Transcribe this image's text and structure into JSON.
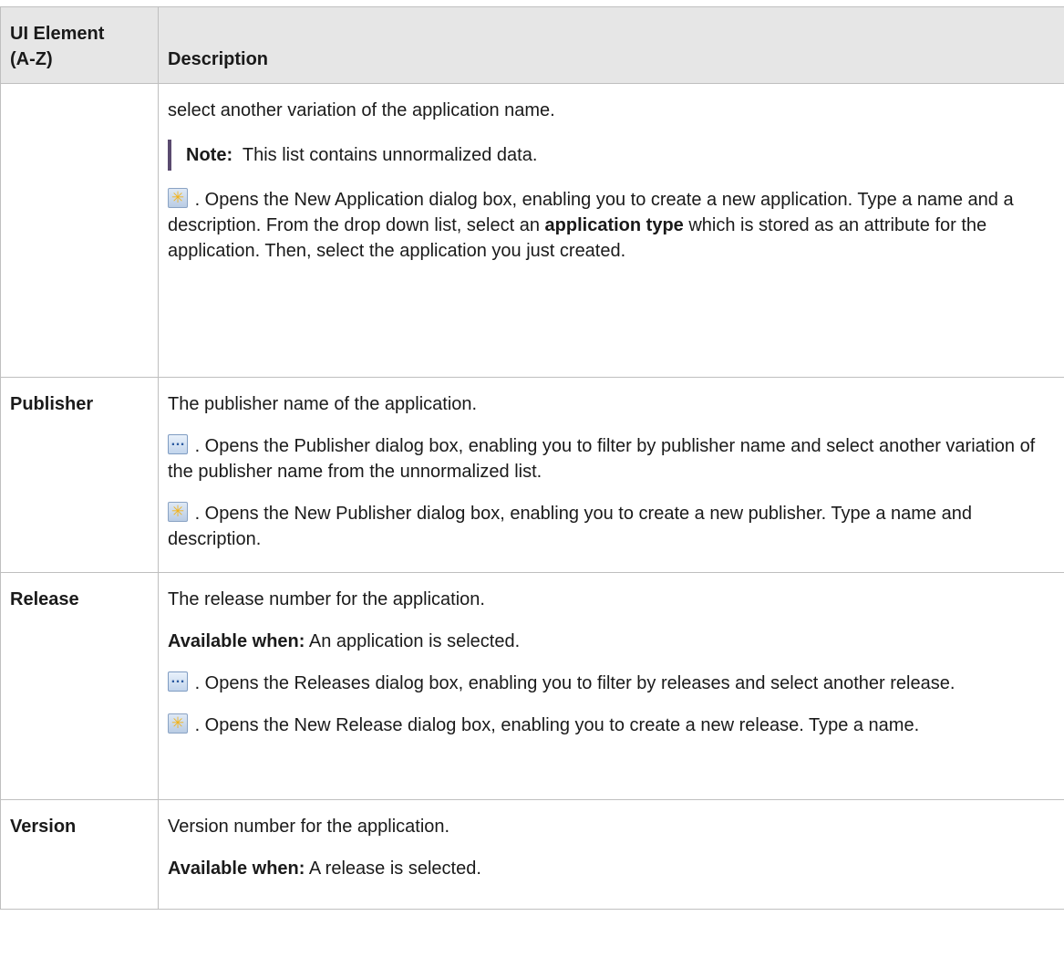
{
  "header": {
    "col1": "UI Element\n(A-Z)",
    "col2": "Description"
  },
  "rows": [
    {
      "name": "",
      "p1": "select another variation of the application name.",
      "note_label": "Note:",
      "note_text": "This list contains unnormalized data.",
      "new_icon": "new-item-icon",
      "p2_pre": ". Opens the New Application dialog box, enabling you to create a new application. Type a name and a description. From the drop down list, select an ",
      "p2_bold": "application type",
      "p2_post": " which is stored as an attribute for the application. Then, select the application you just created."
    },
    {
      "name": "Publisher",
      "p1": "The publisher name of the application.",
      "browse_icon": "browse-icon",
      "p2": ". Opens the Publisher dialog box, enabling you to filter by publisher name and select another variation of the publisher name from the unnormalized list.",
      "new_icon": "new-item-icon",
      "p3": ". Opens the New Publisher dialog box, enabling you to create a new publisher. Type a name and description."
    },
    {
      "name": "Release",
      "p1": "The release number for the application.",
      "avail_label": "Available when:",
      "avail_text": " An application is selected.",
      "browse_icon": "browse-icon",
      "p2": ". Opens the Releases dialog box, enabling you to filter by releases and select another release.",
      "new_icon": "new-item-icon",
      "p3": ". Opens the New Release dialog box, enabling you to create a new release. Type a name."
    },
    {
      "name": "Version",
      "p1": "Version number for the application.",
      "avail_label": "Available when:",
      "avail_text": " A release is selected."
    }
  ]
}
